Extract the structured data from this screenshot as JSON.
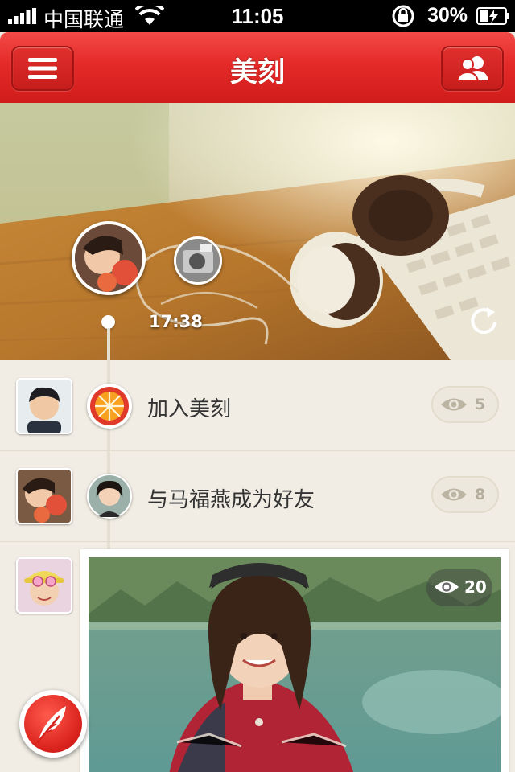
{
  "status_bar": {
    "carrier": "中国联通",
    "time": "11:05",
    "battery_percent": "30%"
  },
  "nav": {
    "title": "美刻",
    "menu_icon": "hamburger-icon",
    "friends_icon": "friends-icon"
  },
  "hero": {
    "time_label": "17:38",
    "refresh_icon": "refresh-icon"
  },
  "feed": {
    "items": [
      {
        "text": "加入美刻",
        "views": "5",
        "badge_icon": "orange-slice-icon"
      },
      {
        "text": "与马福燕成为好友",
        "views": "8",
        "badge_icon": "friend-avatar"
      }
    ],
    "photo_post": {
      "views": "20"
    }
  },
  "compose_icon": "quill-icon",
  "colors": {
    "accent": "#e42a28",
    "background": "#f1ede4",
    "text": "#333333",
    "muted": "#b5ad9d"
  }
}
